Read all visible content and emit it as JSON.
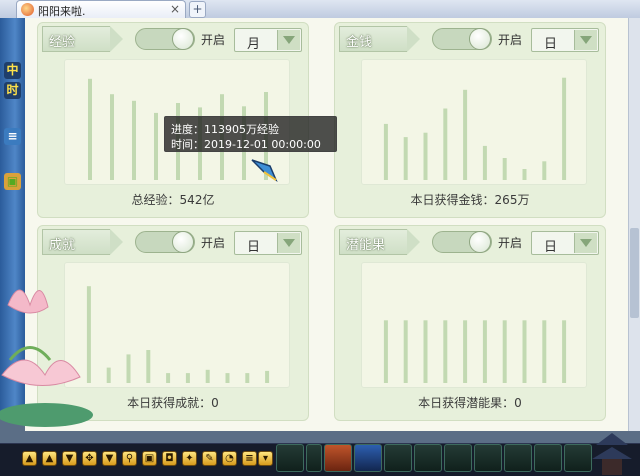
{
  "browser": {
    "tab_title": "阳阳来啦.",
    "tab_close": "×",
    "new_tab": "+"
  },
  "left_strip": {
    "badges": [
      "中",
      "时"
    ]
  },
  "panels": [
    {
      "id": "exp",
      "label": "经验",
      "toggle_label": "开启",
      "toggle_on": true,
      "period": "月",
      "summary": "总经验：542亿",
      "bars": [
        0.92,
        0.78,
        0.72,
        0.61,
        0.7,
        0.66,
        0.78,
        0.67,
        0.8
      ]
    },
    {
      "id": "money",
      "label": "金钱",
      "toggle_label": "开启",
      "toggle_on": true,
      "period": "日",
      "summary": "本日获得金钱：265万",
      "bars": [
        0.51,
        0.39,
        0.43,
        0.65,
        0.82,
        0.31,
        0.2,
        0.1,
        0.17,
        0.93
      ]
    },
    {
      "id": "achievement",
      "label": "成就",
      "toggle_label": "开启",
      "toggle_on": true,
      "period": "日",
      "summary": "本日获得成就：0",
      "bars": [
        0.88,
        0.14,
        0.26,
        0.3,
        0.09,
        0.09,
        0.12,
        0.09,
        0.09,
        0.11
      ]
    },
    {
      "id": "potential",
      "label": "潜能果",
      "toggle_label": "开启",
      "toggle_on": true,
      "period": "日",
      "summary": "本日获得潜能果：0",
      "bars": [
        0.57,
        0.57,
        0.57,
        0.57,
        0.57,
        0.57,
        0.57,
        0.57,
        0.57,
        0.57
      ]
    }
  ],
  "tooltip": {
    "line1": "进度：113905万经验",
    "line2": "时间：2019-12-01 00:00:00"
  },
  "colors": {
    "bar": "#c2d9b2",
    "panel_bg": "#e7f0db",
    "chart_bg": "#f3f6e6"
  }
}
